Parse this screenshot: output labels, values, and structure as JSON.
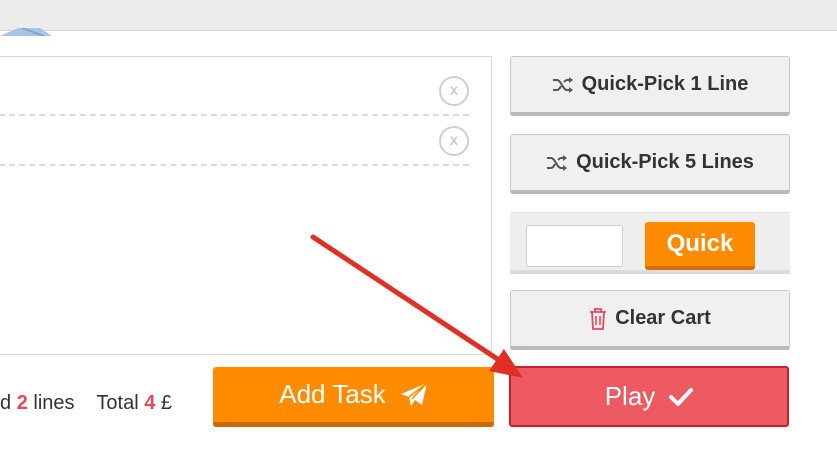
{
  "lines": [
    {
      "remove_label": "x"
    },
    {
      "remove_label": "x"
    }
  ],
  "actions": {
    "quick_pick_1": "Quick-Pick 1 Line",
    "quick_pick_5": "Quick-Pick 5 Lines",
    "quick_input_value": "",
    "quick_button": "Quick",
    "clear_cart": "Clear Cart"
  },
  "summary": {
    "prefix": "d",
    "line_count": "2",
    "lines_label": "lines",
    "total_label": "Total",
    "total_value": "4",
    "currency": "£"
  },
  "buttons": {
    "add_task": "Add Task",
    "play": "Play"
  },
  "colors": {
    "orange": "#ff8c00",
    "play_red": "#ee5a61",
    "highlight_red": "#e8485a",
    "annotation_arrow": "#e03025"
  },
  "icons": {
    "shuffle": "shuffle-icon",
    "trash": "trash-icon",
    "send": "paper-plane-icon",
    "check": "check-icon",
    "remove": "close-circle-icon"
  }
}
